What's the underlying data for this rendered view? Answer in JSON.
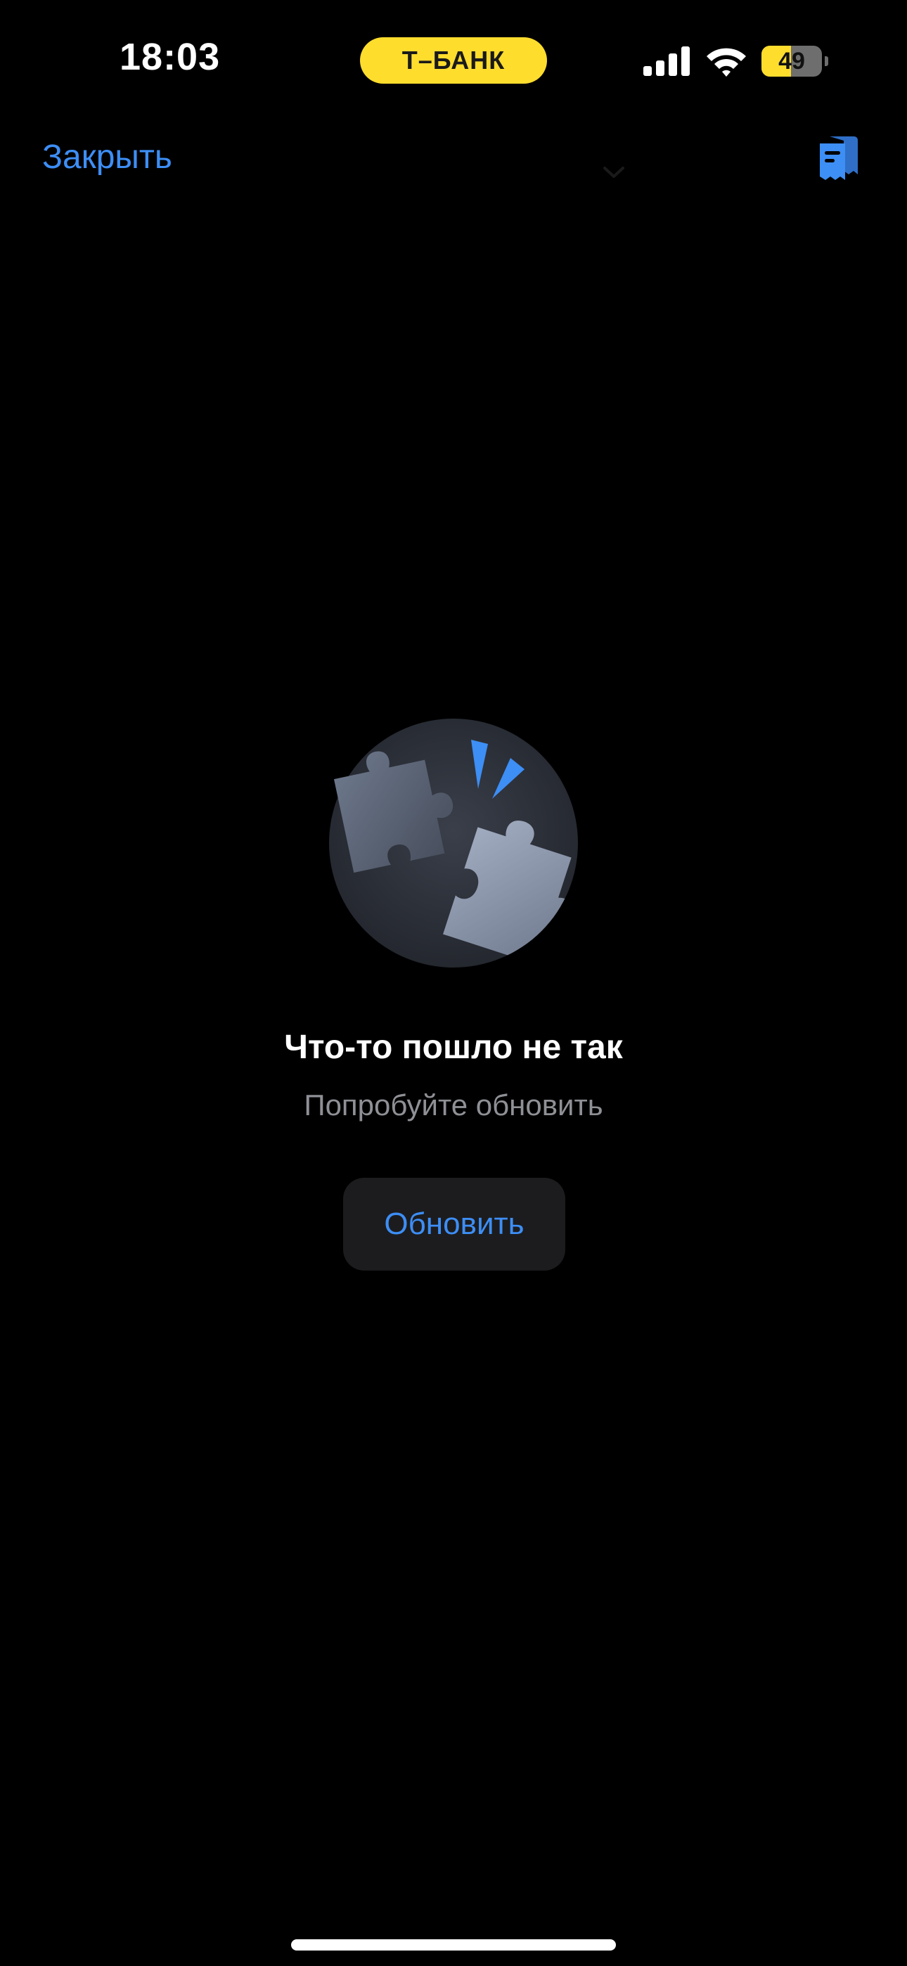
{
  "status_bar": {
    "time": "18:03",
    "carrier_badge": "Т–БАНК",
    "battery_percent": 49,
    "battery_label": "49",
    "signal_icon": "cellular-signal-icon",
    "wifi_icon": "wifi-icon",
    "badge_color": "#FFDD2D"
  },
  "nav": {
    "close_label": "Закрыть",
    "receipt_icon": "receipt-icon",
    "chevron_icon": "chevron-down-icon",
    "accent_color": "#3D8EF5"
  },
  "error_state": {
    "illustration": "puzzle-pieces-illustration",
    "title": "Что-то пошло не так",
    "subtitle": "Попробуйте обновить",
    "refresh_label": "Обновить"
  }
}
